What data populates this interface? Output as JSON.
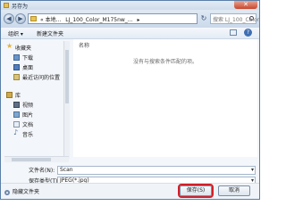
{
  "window": {
    "title": "另存为",
    "close_glyph": "✕"
  },
  "address": {
    "breadcrumbs": [
      "« 本地...",
      "LJ_100_Color_M175nw_...",
      "▸"
    ],
    "search_placeholder": "搜索 LJ_100_Color_M..."
  },
  "toolbar": {
    "organize": "组织 ▾",
    "new_folder": "新建文件夹",
    "help": "?"
  },
  "nav": {
    "items": [
      {
        "label": "收藏夹",
        "icon": "star-icon",
        "group": true
      },
      {
        "label": "下载",
        "icon": "download-folder-icon"
      },
      {
        "label": "桌面",
        "icon": "desktop-icon"
      },
      {
        "label": "最近访问的位置",
        "icon": "recent-places-icon"
      },
      {
        "label": "库",
        "icon": "library-icon",
        "group": true
      },
      {
        "label": "视频",
        "icon": "video-library-icon"
      },
      {
        "label": "图片",
        "icon": "pictures-library-icon"
      },
      {
        "label": "文档",
        "icon": "documents-library-icon"
      },
      {
        "label": "音乐",
        "icon": "music-library-icon"
      }
    ]
  },
  "content": {
    "column_header": "名称",
    "empty_message": "没有与搜索条件匹配的项。"
  },
  "form": {
    "filename_label": "文件名(N):",
    "filename_value": "Scan",
    "type_label": "保存类型(T):",
    "type_value": "JPEG(*.jpg)"
  },
  "footer": {
    "hide_folders": "隐藏文件夹",
    "save": "保存(S)",
    "cancel": "取消"
  },
  "colors": {
    "highlight": "#d0202a",
    "accent": "#3f6fb3"
  }
}
